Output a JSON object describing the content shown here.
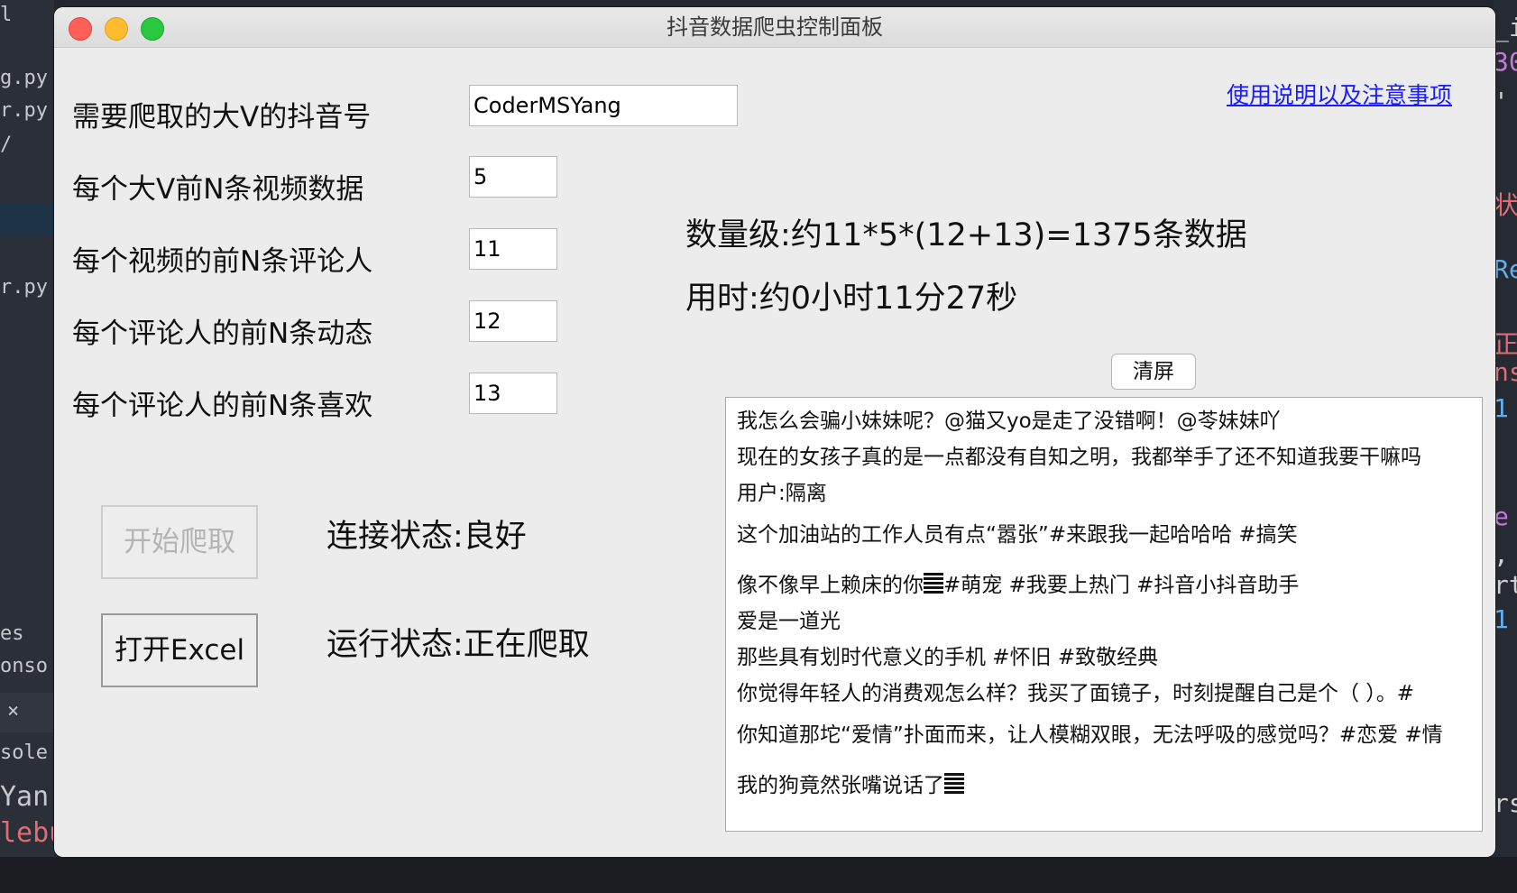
{
  "window": {
    "title": "抖音数据爬虫控制面板"
  },
  "form": {
    "fields": [
      {
        "label": "需要爬取的大V的抖音号",
        "value": "CoderMSYang"
      },
      {
        "label": "每个大V前N条视频数据",
        "value": "5"
      },
      {
        "label": "每个视频的前N条评论人",
        "value": "11"
      },
      {
        "label": "每个评论人的前N条动态",
        "value": "12"
      },
      {
        "label": "每个评论人的前N条喜欢",
        "value": "13"
      }
    ]
  },
  "help_link": "使用说明以及注意事项",
  "estimate": {
    "quantity": "数量级:约11*5*(12+13)=1375条数据",
    "time": "用时:约0小时11分27秒"
  },
  "buttons": {
    "start": "开始爬取",
    "open_excel": "打开Excel",
    "clear": "清屏"
  },
  "status": {
    "connection": "连接状态:良好",
    "running": "运行状态:正在爬取"
  },
  "log": {
    "lines": [
      "我怎么会骗小妹妹呢？@猫又yo是走了没错啊！@苓妹妹吖",
      "现在的女孩子真的是一点都没有自知之明，我都举手了还不知道我要干嘛吗",
      "用户:隔离",
      "这个加油站的工作人员有点“嚣张”#来跟我一起哈哈哈 #搞笑",
      "像不像早上赖床的你",
      "#萌宠 #我要上热门 #抖音小抖音助手",
      "爱是一道光",
      "那些具有划时代意义的手机 #怀旧  #致敬经典",
      "你觉得年轻人的消费观怎么样？我买了面镜子，时刻提醒自己是个（    ）。#",
      "你知道那坨“爱情”扑面而来，让人模糊双眼，无法呼吸的感觉吗？#恋爱 #情",
      "我的狗竟然张嘴说话了"
    ]
  },
  "background": {
    "left_snippets": [
      "l",
      "g.py",
      "r.py",
      "/",
      "r.py",
      "es",
      "onso",
      "×",
      "sole",
      "Yan",
      "lebu"
    ],
    "right_snippets": [
      "_i",
      "30",
      "'",
      "Re",
      "状",
      "正",
      "ns",
      "1",
      "e",
      ",",
      "rt",
      "1",
      "rs"
    ]
  }
}
